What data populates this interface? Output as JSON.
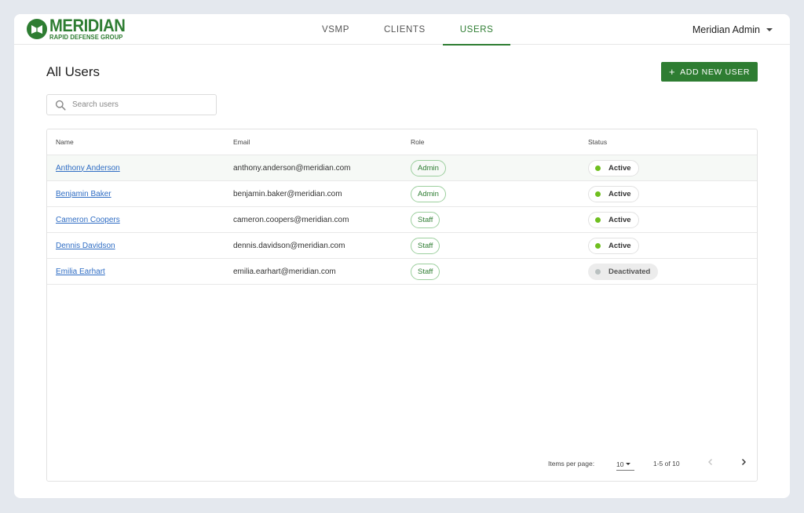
{
  "brand": {
    "name": "MERIDIAN",
    "tagline": "RAPID DEFENSE GROUP",
    "color": "#2e7d32"
  },
  "nav": {
    "tabs": [
      {
        "label": "VSMP",
        "active": false
      },
      {
        "label": "CLIENTS",
        "active": false
      },
      {
        "label": "USERS",
        "active": true
      }
    ]
  },
  "user_menu": {
    "label": "Meridian Admin",
    "icon": "chevron-down-icon"
  },
  "page": {
    "title": "All Users",
    "add_button_label": "ADD NEW USER",
    "add_button_icon": "plus-icon"
  },
  "search": {
    "placeholder": "Search users",
    "value": "",
    "icon": "search-icon"
  },
  "table": {
    "headers": [
      "Name",
      "Email",
      "Role",
      "Status"
    ],
    "rows": [
      {
        "name": "Anthony Anderson",
        "email": "anthony.anderson@meridian.com",
        "role": "Admin",
        "status": "Active"
      },
      {
        "name": "Benjamin Baker",
        "email": "benjamin.baker@meridian.com",
        "role": "Admin",
        "status": "Active"
      },
      {
        "name": "Cameron Coopers",
        "email": "cameron.coopers@meridian.com",
        "role": "Staff",
        "status": "Active"
      },
      {
        "name": "Dennis Davidson",
        "email": "dennis.davidson@meridian.com",
        "role": "Staff",
        "status": "Active"
      },
      {
        "name": "Emilia Earhart",
        "email": "emilia.earhart@meridian.com",
        "role": "Staff",
        "status": "Deactivated"
      }
    ]
  },
  "status_colors": {
    "Active": "#6fbf1f",
    "Deactivated": "#b9c0c0"
  },
  "pagination": {
    "items_per_page_label": "Items per page:",
    "items_per_page": "10",
    "range": "1-5 of 10"
  }
}
